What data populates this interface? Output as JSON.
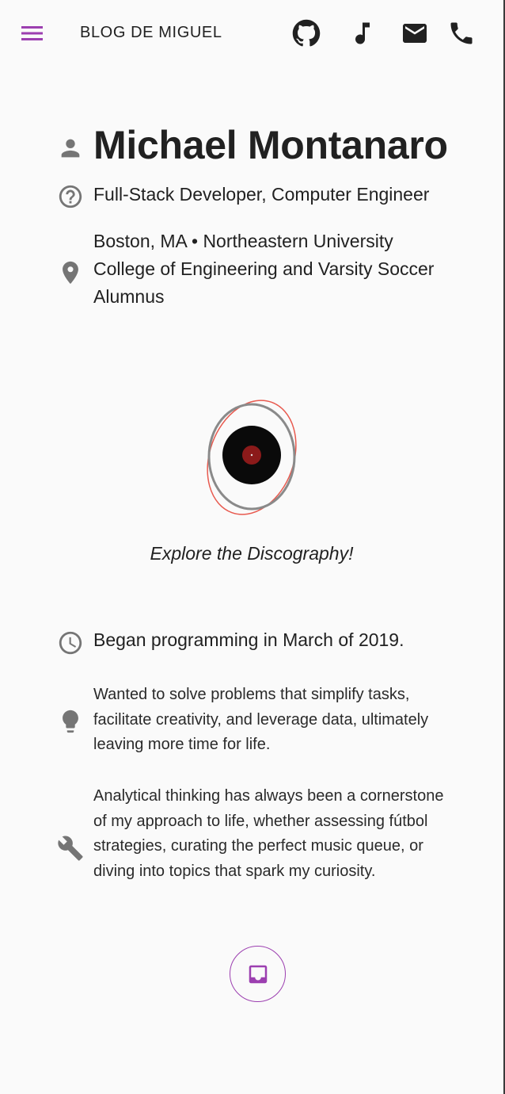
{
  "header": {
    "brand": "BLOG DE MIGUEL",
    "icons": [
      "menu-icon",
      "github-icon",
      "music-note-icon",
      "mail-icon",
      "phone-icon"
    ]
  },
  "profile": {
    "name": "Michael Montanaro",
    "title": "Full-Stack Developer, Computer Engineer",
    "location": "Boston, MA • Northeastern University College of Engineering and Varsity Soccer Alumnus"
  },
  "discography": {
    "caption": "Explore the Discography!"
  },
  "facts": [
    {
      "icon": "clock-icon",
      "text": "Began programming in March of 2019."
    },
    {
      "icon": "lightbulb-icon",
      "text": "Wanted to solve problems that simplify tasks, facilitate creativity, and leverage data, ultimately leaving more time for life."
    },
    {
      "icon": "wrench-icon",
      "text": "Analytical thinking has always been a cornerstone of my approach to life, whether assessing fútbol strategies, curating the perfect music queue, or diving into topics that spark my curiosity."
    }
  ],
  "colors": {
    "accent": "#9c3fb0",
    "icon_gray": "#757575",
    "record_outline": "#e85a4f"
  }
}
